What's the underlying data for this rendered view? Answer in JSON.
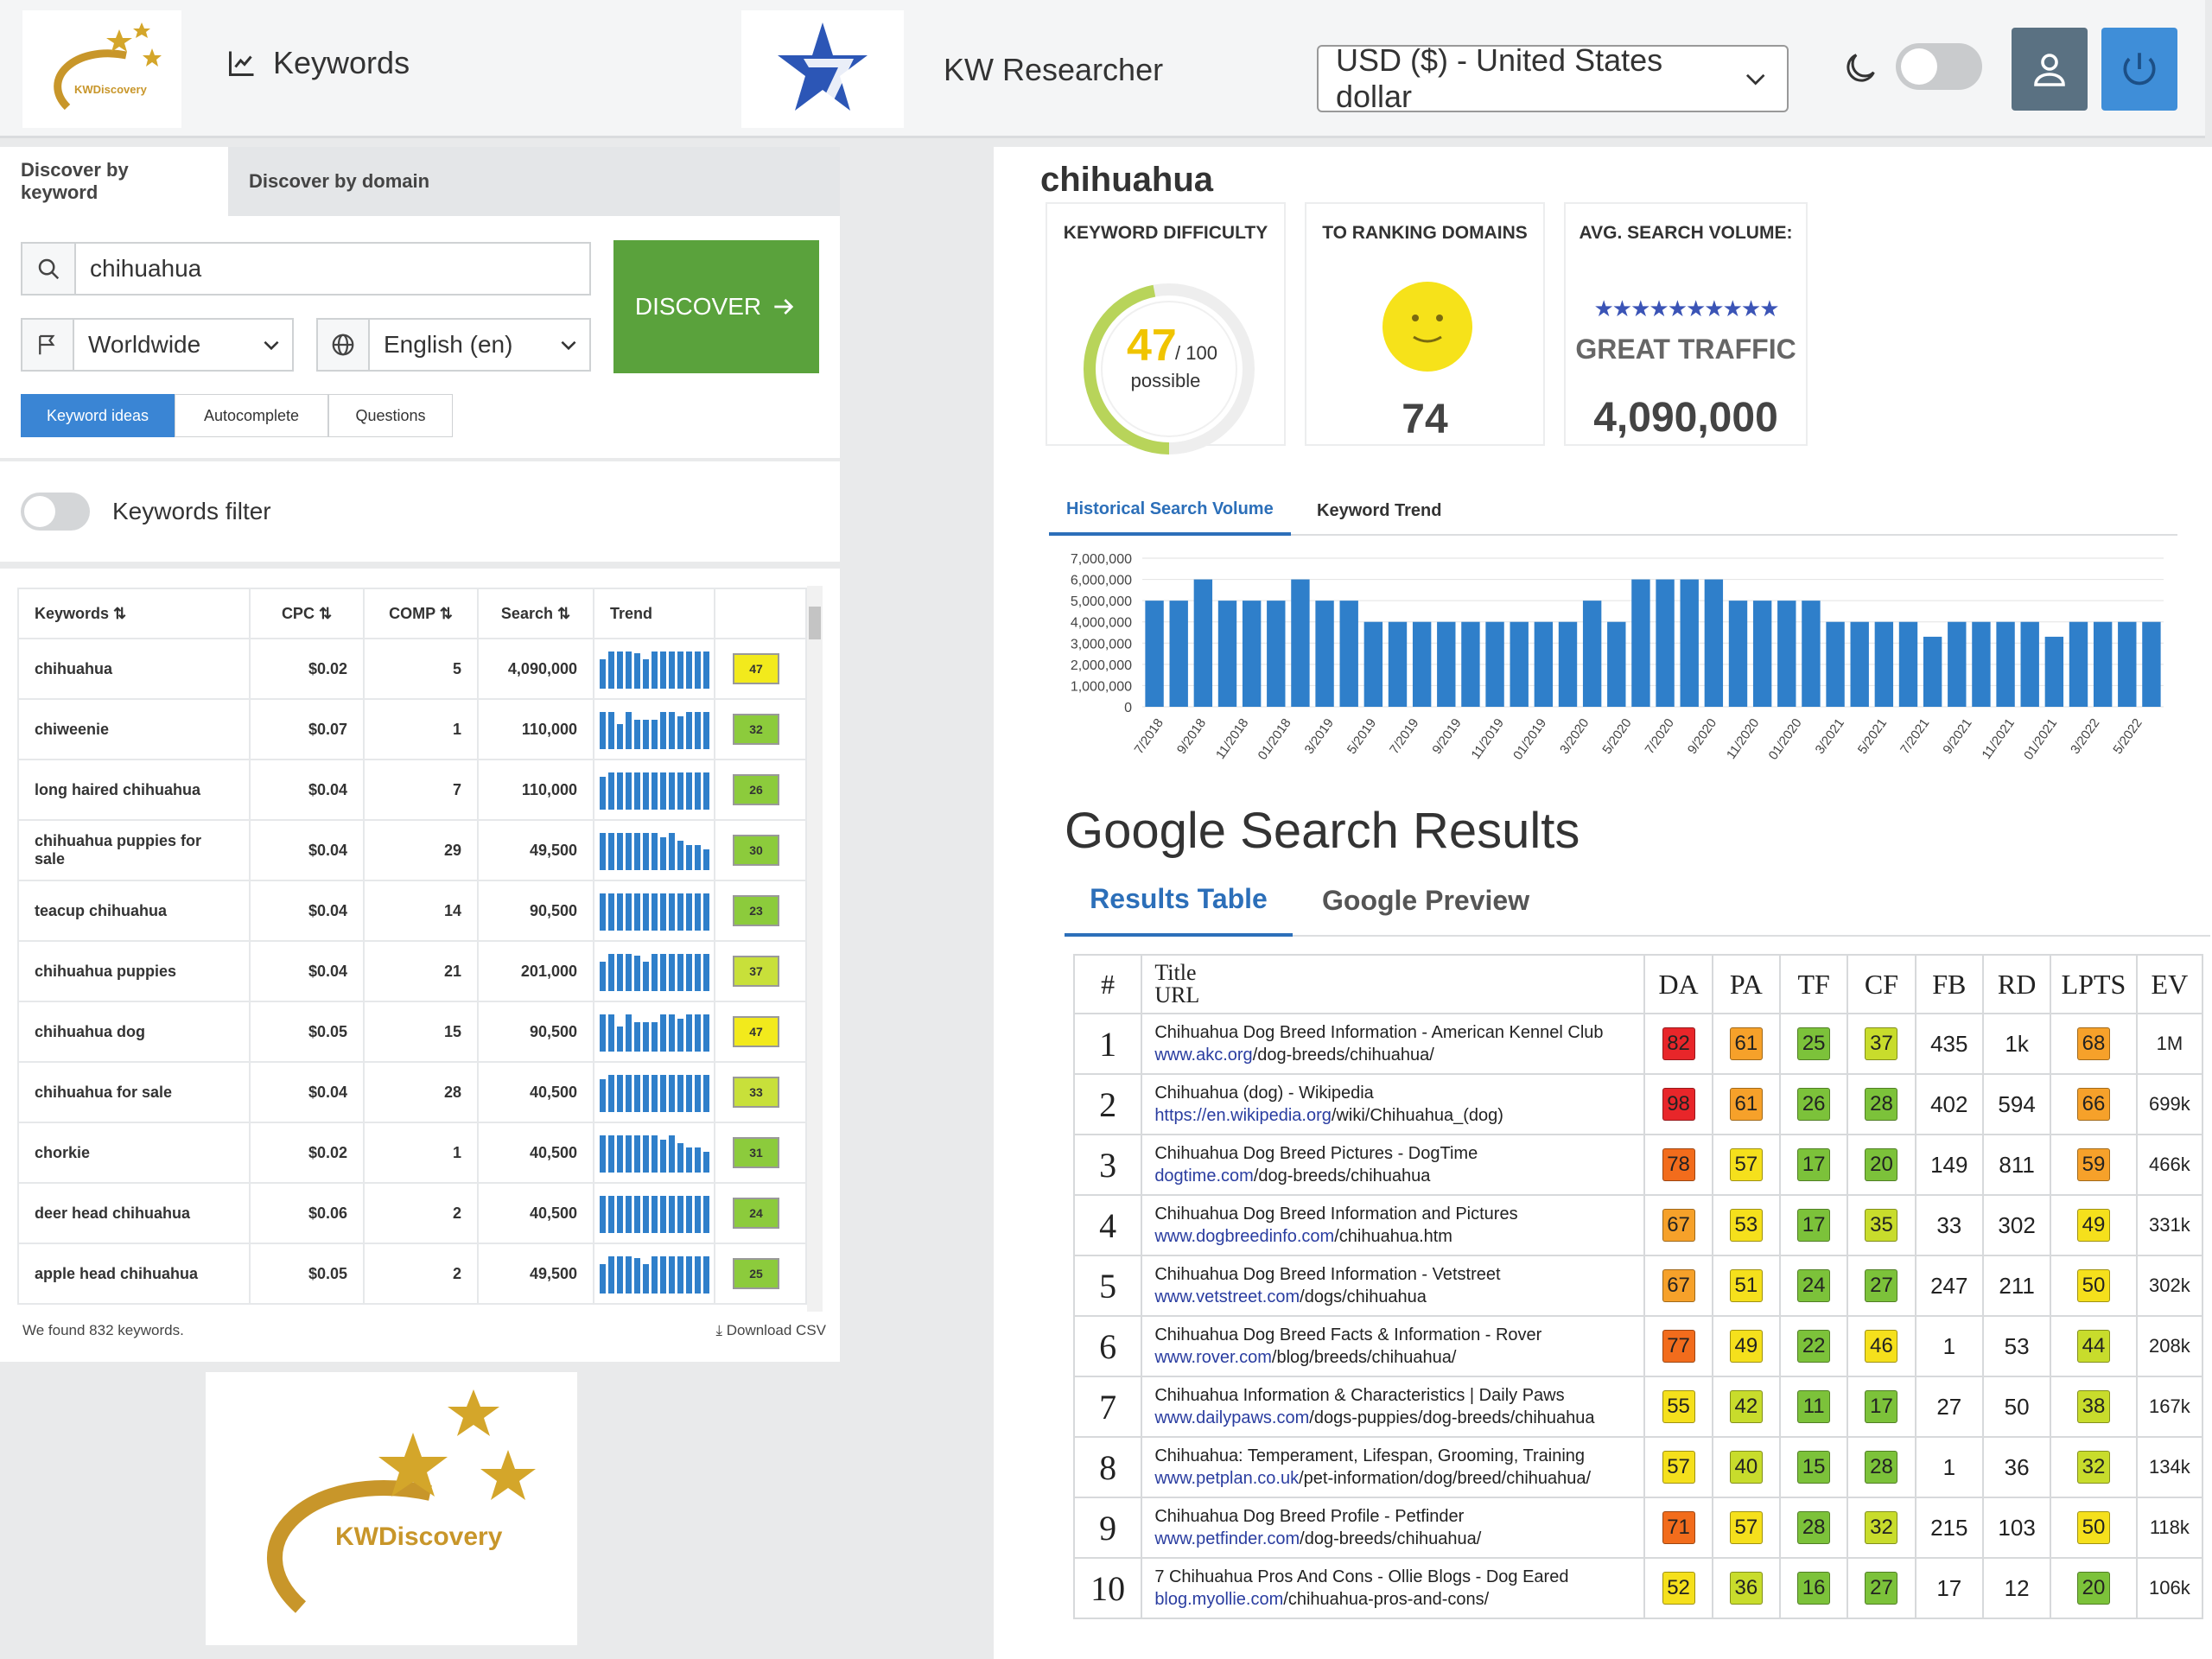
{
  "header": {
    "logo_text": "KWDiscovery",
    "nav_label": "Keywords",
    "app_title": "KW Researcher",
    "currency": "USD ($) - United States dollar"
  },
  "left": {
    "tabs": [
      "Discover by keyword",
      "Discover by domain"
    ],
    "search_value": "chihuahua",
    "location": "Worldwide",
    "language": "English (en)",
    "discover_label": "DISCOVER",
    "modes": [
      "Keyword ideas",
      "Autocomplete",
      "Questions"
    ],
    "filter_label": "Keywords filter",
    "columns": [
      "Keywords",
      "CPC",
      "COMP",
      "Search",
      "Trend"
    ],
    "rows": [
      {
        "kw": "chihuahua",
        "cpc": "$0.02",
        "comp": "5",
        "search": "4,090,000",
        "kd": 47
      },
      {
        "kw": "chiweenie",
        "cpc": "$0.07",
        "comp": "1",
        "search": "110,000",
        "kd": 32
      },
      {
        "kw": "long haired chihuahua",
        "cpc": "$0.04",
        "comp": "7",
        "search": "110,000",
        "kd": 26
      },
      {
        "kw": "chihuahua puppies for sale",
        "cpc": "$0.04",
        "comp": "29",
        "search": "49,500",
        "kd": 30
      },
      {
        "kw": "teacup chihuahua",
        "cpc": "$0.04",
        "comp": "14",
        "search": "90,500",
        "kd": 23
      },
      {
        "kw": "chihuahua puppies",
        "cpc": "$0.04",
        "comp": "21",
        "search": "201,000",
        "kd": 37
      },
      {
        "kw": "chihuahua dog",
        "cpc": "$0.05",
        "comp": "15",
        "search": "90,500",
        "kd": 47
      },
      {
        "kw": "chihuahua for sale",
        "cpc": "$0.04",
        "comp": "28",
        "search": "40,500",
        "kd": 33
      },
      {
        "kw": "chorkie",
        "cpc": "$0.02",
        "comp": "1",
        "search": "40,500",
        "kd": 31
      },
      {
        "kw": "deer head chihuahua",
        "cpc": "$0.06",
        "comp": "2",
        "search": "40,500",
        "kd": 24
      },
      {
        "kw": "apple head chihuahua",
        "cpc": "$0.05",
        "comp": "2",
        "search": "49,500",
        "kd": 25
      }
    ],
    "found_text": "We found 832 keywords.",
    "download_label": "Download CSV"
  },
  "right": {
    "keyword": "chihuahua",
    "kd_label": "KEYWORD DIFFICULTY",
    "kd_value": "47",
    "kd_max": "/ 100",
    "kd_status": "possible",
    "kd_fraction": 0.47,
    "domains_label": "TO RANKING DOMAINS",
    "domains_value": "74",
    "volume_label": "AVG. SEARCH VOLUME:",
    "stars": "★★★★★★★★★★",
    "traffic_label": "GREAT TRAFFIC",
    "volume_value": "4,090,000",
    "chart_tabs": [
      "Historical Search Volume",
      "Keyword Trend"
    ],
    "gsr_title": "Google Search Results",
    "gsr_tabs": [
      "Results Table",
      "Google Preview"
    ],
    "res_columns": [
      "#",
      "Title",
      "URL",
      "DA",
      "PA",
      "TF",
      "CF",
      "FB",
      "RD",
      "LPTS",
      "EV"
    ],
    "results": [
      {
        "n": "1",
        "title": "Chihuahua Dog Breed Information - American Kennel Club",
        "domain": "www.akc.org",
        "path": "/dog-breeds/chihuahua/",
        "da": 82,
        "pa": 61,
        "tf": 25,
        "cf": 37,
        "fb": "435",
        "rd": "1k",
        "lpts": 68,
        "ev": "1M"
      },
      {
        "n": "2",
        "title": "Chihuahua (dog) - Wikipedia",
        "domain": "https://en.wikipedia.org",
        "path": "/wiki/Chihuahua_(dog)",
        "da": 98,
        "pa": 61,
        "tf": 26,
        "cf": 28,
        "fb": "402",
        "rd": "594",
        "lpts": 66,
        "ev": "699k"
      },
      {
        "n": "3",
        "title": "Chihuahua Dog Breed Pictures - DogTime",
        "domain": "dogtime.com",
        "path": "/dog-breeds/chihuahua",
        "da": 78,
        "pa": 57,
        "tf": 17,
        "cf": 20,
        "fb": "149",
        "rd": "811",
        "lpts": 59,
        "ev": "466k"
      },
      {
        "n": "4",
        "title": "Chihuahua Dog Breed Information and Pictures",
        "domain": "www.dogbreedinfo.com",
        "path": "/chihuahua.htm",
        "da": 67,
        "pa": 53,
        "tf": 17,
        "cf": 35,
        "fb": "33",
        "rd": "302",
        "lpts": 49,
        "ev": "331k"
      },
      {
        "n": "5",
        "title": "Chihuahua Dog Breed Information - Vetstreet",
        "domain": "www.vetstreet.com",
        "path": "/dogs/chihuahua",
        "da": 67,
        "pa": 51,
        "tf": 24,
        "cf": 27,
        "fb": "247",
        "rd": "211",
        "lpts": 50,
        "ev": "302k"
      },
      {
        "n": "6",
        "title": "Chihuahua Dog Breed Facts & Information - Rover",
        "domain": "www.rover.com",
        "path": "/blog/breeds/chihuahua/",
        "da": 77,
        "pa": 49,
        "tf": 22,
        "cf": 46,
        "fb": "1",
        "rd": "53",
        "lpts": 44,
        "ev": "208k"
      },
      {
        "n": "7",
        "title": "Chihuahua Information & Characteristics | Daily Paws",
        "domain": "www.dailypaws.com",
        "path": "/dogs-puppies/dog-breeds/chihuahua",
        "da": 55,
        "pa": 42,
        "tf": 11,
        "cf": 17,
        "fb": "27",
        "rd": "50",
        "lpts": 38,
        "ev": "167k"
      },
      {
        "n": "8",
        "title": "Chihuahua: Temperament, Lifespan, Grooming, Training",
        "domain": "www.petplan.co.uk",
        "path": "/pet-information/dog/breed/chihuahua/",
        "da": 57,
        "pa": 40,
        "tf": 15,
        "cf": 28,
        "fb": "1",
        "rd": "36",
        "lpts": 32,
        "ev": "134k"
      },
      {
        "n": "9",
        "title": "Chihuahua Dog Breed Profile - Petfinder",
        "domain": "www.petfinder.com",
        "path": "/dog-breeds/chihuahua/",
        "da": 71,
        "pa": 57,
        "tf": 28,
        "cf": 32,
        "fb": "215",
        "rd": "103",
        "lpts": 50,
        "ev": "118k"
      },
      {
        "n": "10",
        "title": "7 Chihuahua Pros And Cons - Ollie Blogs - Dog Eared",
        "domain": "blog.myollie.com",
        "path": "/chihuahua-pros-and-cons/",
        "da": 52,
        "pa": 36,
        "tf": 16,
        "cf": 27,
        "fb": "17",
        "rd": "12",
        "lpts": 20,
        "ev": "106k"
      }
    ]
  },
  "chart_data": {
    "type": "bar",
    "title": "",
    "xlabel": "",
    "ylabel": "",
    "ylim": [
      0,
      7000000
    ],
    "yticks": [
      "7,000,000",
      "6,000,000",
      "5,000,000",
      "4,000,000",
      "3,000,000",
      "2,000,000",
      "1,000,000",
      "0"
    ],
    "xtick_labels": [
      "7/2018",
      "9/2018",
      "11/2018",
      "01/2018",
      "3/2019",
      "5/2019",
      "7/2019",
      "9/2019",
      "11/2019",
      "01/2019",
      "3/2020",
      "5/2020",
      "7/2020",
      "9/2020",
      "11/2020",
      "01/2020",
      "3/2021",
      "5/2021",
      "7/2021",
      "9/2021",
      "11/2021",
      "01/2021",
      "3/2022",
      "5/2022"
    ],
    "values": [
      5000000,
      5000000,
      6000000,
      5000000,
      5000000,
      5000000,
      6000000,
      5000000,
      5000000,
      4000000,
      4000000,
      4000000,
      4000000,
      4000000,
      4000000,
      4000000,
      4000000,
      4000000,
      5000000,
      4000000,
      6000000,
      6000000,
      6000000,
      6000000,
      5000000,
      5000000,
      5000000,
      5000000,
      4000000,
      4000000,
      4000000,
      4000000,
      3300000,
      4000000,
      4000000,
      4000000,
      4000000,
      3300000,
      4000000,
      4000000,
      4000000,
      4000000
    ],
    "color": "#2f7fca",
    "grid": true
  }
}
